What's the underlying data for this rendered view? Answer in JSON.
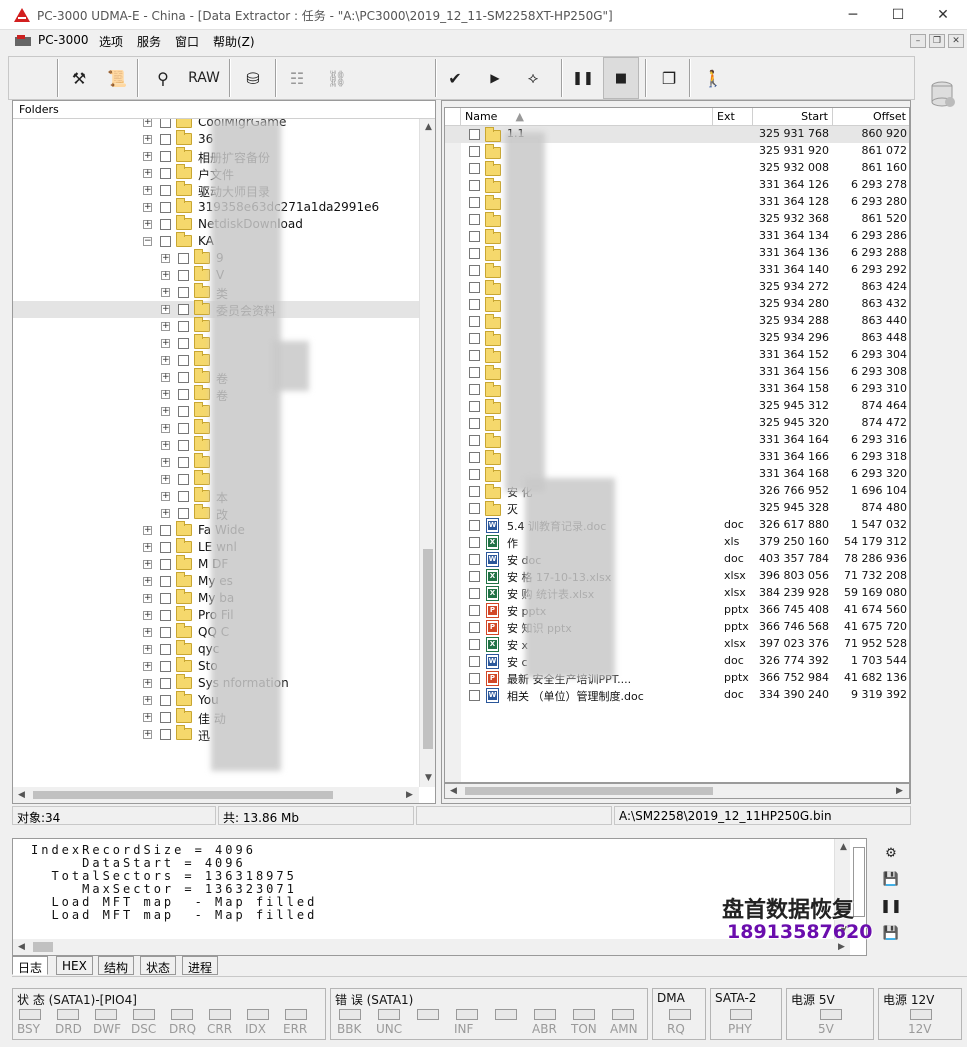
{
  "window": {
    "title": "PC-3000 UDMA-E - China - [Data Extractor : 任务 - \"A:\\PC3000\\2019_12_11-SM2258XT-HP250G\"]",
    "minimize": "─",
    "maximize": "☐",
    "close": "✕"
  },
  "menu": {
    "items": [
      "PC-3000",
      "选项",
      "服务",
      "窗口",
      "帮助(Z)"
    ],
    "mdi": [
      "–",
      "❐",
      "✕"
    ]
  },
  "toolbar": {
    "raw_label": "RAW"
  },
  "folders": {
    "header": "Folders",
    "items": [
      {
        "label": "CoolMigrGame"
      },
      {
        "label": "36"
      },
      {
        "label": "相册扩容备份"
      },
      {
        "label": "户文件"
      },
      {
        "label": "驱动大师目录"
      },
      {
        "label": "319358e63dc271a1da2991e6"
      },
      {
        "label": "NetdiskDownload"
      },
      {
        "label": "KA"
      },
      {
        "label": "9"
      },
      {
        "label": "V"
      },
      {
        "label": "类"
      },
      {
        "label": "委员会资料"
      },
      {
        "label": ""
      },
      {
        "label": ""
      },
      {
        "label": ""
      },
      {
        "label": "卷"
      },
      {
        "label": "卷"
      },
      {
        "label": ""
      },
      {
        "label": ""
      },
      {
        "label": ""
      },
      {
        "label": ""
      },
      {
        "label": ""
      },
      {
        "label": "本"
      },
      {
        "label": "改"
      },
      {
        "label": "Fa Wide"
      },
      {
        "label": "LE wnl"
      },
      {
        "label": "M DF"
      },
      {
        "label": "My es"
      },
      {
        "label": "My ba"
      },
      {
        "label": "Pro Fil"
      },
      {
        "label": "QQ C"
      },
      {
        "label": "qyc"
      },
      {
        "label": "Sto"
      },
      {
        "label": "Sys nformation"
      },
      {
        "label": "You"
      },
      {
        "label": "佳 动"
      },
      {
        "label": "迅"
      }
    ]
  },
  "files": {
    "columns": {
      "name": "Name",
      "ext": "Ext",
      "start": "Start",
      "offset": "Offset"
    },
    "rows": [
      {
        "name": "1.1",
        "ext": "",
        "start": "325 931 768",
        "offset": "860 920",
        "type": "folder"
      },
      {
        "name": "",
        "ext": "",
        "start": "325 931 920",
        "offset": "861 072",
        "type": "folder"
      },
      {
        "name": "",
        "ext": "",
        "start": "325 932 008",
        "offset": "861 160",
        "type": "folder"
      },
      {
        "name": "",
        "ext": "",
        "start": "331 364 126",
        "offset": "6 293 278",
        "type": "folder"
      },
      {
        "name": "",
        "ext": "",
        "start": "331 364 128",
        "offset": "6 293 280",
        "type": "folder"
      },
      {
        "name": "",
        "ext": "",
        "start": "325 932 368",
        "offset": "861 520",
        "type": "folder"
      },
      {
        "name": "",
        "ext": "",
        "start": "331 364 134",
        "offset": "6 293 286",
        "type": "folder"
      },
      {
        "name": "",
        "ext": "",
        "start": "331 364 136",
        "offset": "6 293 288",
        "type": "folder"
      },
      {
        "name": "",
        "ext": "",
        "start": "331 364 140",
        "offset": "6 293 292",
        "type": "folder"
      },
      {
        "name": "",
        "ext": "",
        "start": "325 934 272",
        "offset": "863 424",
        "type": "folder"
      },
      {
        "name": "",
        "ext": "",
        "start": "325 934 280",
        "offset": "863 432",
        "type": "folder"
      },
      {
        "name": "",
        "ext": "",
        "start": "325 934 288",
        "offset": "863 440",
        "type": "folder"
      },
      {
        "name": "",
        "ext": "",
        "start": "325 934 296",
        "offset": "863 448",
        "type": "folder"
      },
      {
        "name": "",
        "ext": "",
        "start": "331 364 152",
        "offset": "6 293 304",
        "type": "folder"
      },
      {
        "name": "",
        "ext": "",
        "start": "331 364 156",
        "offset": "6 293 308",
        "type": "folder"
      },
      {
        "name": "",
        "ext": "",
        "start": "331 364 158",
        "offset": "6 293 310",
        "type": "folder"
      },
      {
        "name": "",
        "ext": "",
        "start": "325 945 312",
        "offset": "874 464",
        "type": "folder"
      },
      {
        "name": "",
        "ext": "",
        "start": "325 945 320",
        "offset": "874 472",
        "type": "folder"
      },
      {
        "name": "",
        "ext": "",
        "start": "331 364 164",
        "offset": "6 293 316",
        "type": "folder"
      },
      {
        "name": "",
        "ext": "",
        "start": "331 364 166",
        "offset": "6 293 318",
        "type": "folder"
      },
      {
        "name": "",
        "ext": "",
        "start": "331 364 168",
        "offset": "6 293 320",
        "type": "folder"
      },
      {
        "name": "安 化",
        "ext": "",
        "start": "326 766 952",
        "offset": "1 696 104",
        "type": "folder"
      },
      {
        "name": "灭",
        "ext": "",
        "start": "325 945 328",
        "offset": "874 480",
        "type": "folder"
      },
      {
        "name": "5.4 训教育记录.doc",
        "ext": "doc",
        "start": "326 617 880",
        "offset": "1 547 032",
        "type": "doc"
      },
      {
        "name": "作",
        "ext": "xls",
        "start": "379 250 160",
        "offset": "54 179 312",
        "type": "xls"
      },
      {
        "name": "安 doc",
        "ext": "doc",
        "start": "403 357 784",
        "offset": "78 286 936",
        "type": "doc"
      },
      {
        "name": "安 格 17-10-13.xlsx",
        "ext": "xlsx",
        "start": "396 803 056",
        "offset": "71 732 208",
        "type": "xls"
      },
      {
        "name": "安 购 统计表.xlsx",
        "ext": "xlsx",
        "start": "384 239 928",
        "offset": "59 169 080",
        "type": "xls"
      },
      {
        "name": "安 pptx",
        "ext": "pptx",
        "start": "366 745 408",
        "offset": "41 674 560",
        "type": "ppt"
      },
      {
        "name": "安 知识 pptx",
        "ext": "pptx",
        "start": "366 746 568",
        "offset": "41 675 720",
        "type": "ppt"
      },
      {
        "name": "安 x",
        "ext": "xlsx",
        "start": "397 023 376",
        "offset": "71 952 528",
        "type": "xls"
      },
      {
        "name": "安 c",
        "ext": "doc",
        "start": "326 774 392",
        "offset": "1 703 544",
        "type": "doc"
      },
      {
        "name": "最新 安全生产培训PPT....",
        "ext": "pptx",
        "start": "366 752 984",
        "offset": "41 682 136",
        "type": "ppt"
      },
      {
        "name": "相关 （单位）管理制度.doc",
        "ext": "doc",
        "start": "334 390 240",
        "offset": "9 319 392",
        "type": "doc"
      }
    ]
  },
  "status": {
    "objects": "对象:34",
    "total": "共: 13.86 Mb",
    "path": "A:\\SM2258\\2019_12_11HP250G.bin"
  },
  "log": {
    "lines": [
      "IndexRecordSize = 4096",
      "     DataStart = 4096",
      "  TotalSectors = 136318975",
      "     MaxSector = 136323071",
      "  Load MFT map  - Map filled",
      "  Load MFT map  - Map filled"
    ],
    "tabs": [
      "日志",
      "HEX",
      "结构",
      "状态",
      "进程"
    ]
  },
  "watermark": {
    "line1": "盘首数据恢复",
    "line2": "18913587620",
    "line2_color": "#6a0dad"
  },
  "bottom": {
    "groups": [
      {
        "title": "状 态 (SATA1)-[PIO4]",
        "leds": [
          "BSY",
          "DRD",
          "DWF",
          "DSC",
          "DRQ",
          "CRR",
          "IDX",
          "ERR"
        ]
      },
      {
        "title": "错 误 (SATA1)",
        "leds": [
          "BBK",
          "UNC",
          "",
          "INF",
          "",
          "ABR",
          "TON",
          "AMN"
        ]
      },
      {
        "title": "DMA",
        "leds": [
          "RQ"
        ]
      },
      {
        "title": "SATA-2",
        "leds": [
          "PHY"
        ]
      },
      {
        "title": "电源 5V",
        "leds": [
          "5V"
        ]
      },
      {
        "title": "电源 12V",
        "leds": [
          "12V"
        ]
      }
    ]
  },
  "colors": {
    "folder": "#f5d86c",
    "accent": "#d21f1f"
  }
}
